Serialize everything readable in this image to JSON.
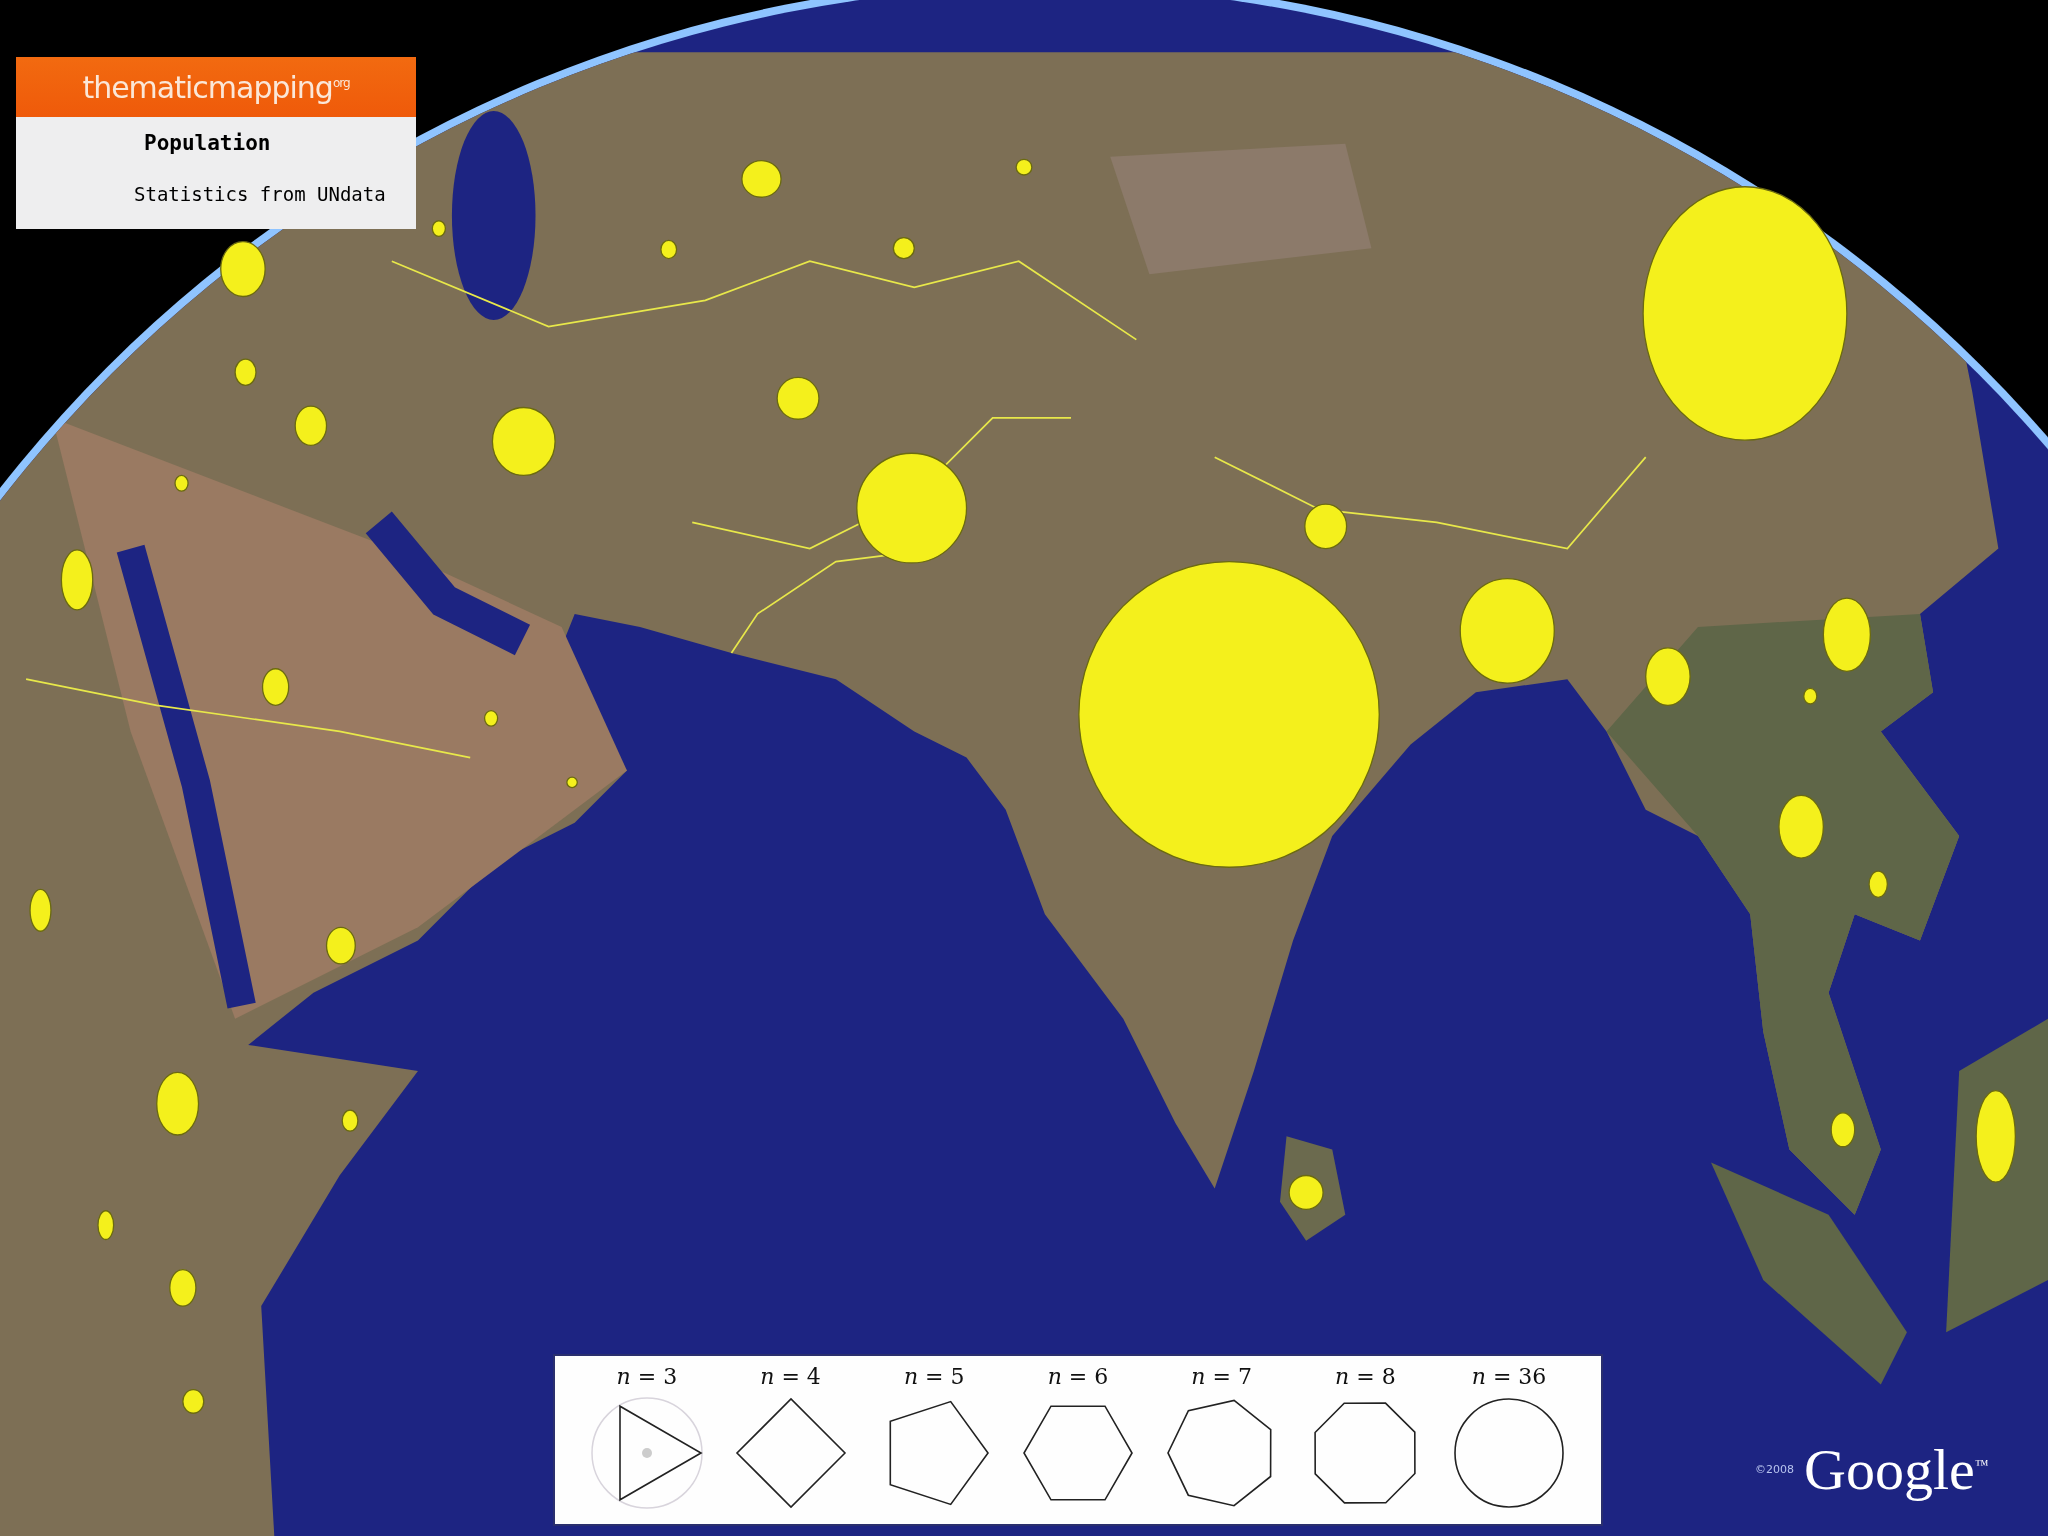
{
  "logo_panel": {
    "brand": "thematicmapping$^{org}$",
    "title": "Population",
    "subtitle": "Statistics from UNdata"
  },
  "legend": {
    "items": [
      {
        "label": "*n* = 3",
        "kind": "triangle"
      },
      {
        "label": "*n* = 4",
        "kind": "square"
      },
      {
        "label": "*n* = 5",
        "kind": "pentagon"
      },
      {
        "label": "*n* = 6",
        "kind": "hexagon"
      },
      {
        "label": "*n* = 7",
        "kind": "heptagon"
      },
      {
        "label": "*n* = 8",
        "kind": "octagon"
      },
      {
        "label": "*n* = 36",
        "kind": "circle"
      }
    ]
  },
  "attribution": {
    "copyright": "©2008",
    "logo": "Google$^{™}$"
  }
}
